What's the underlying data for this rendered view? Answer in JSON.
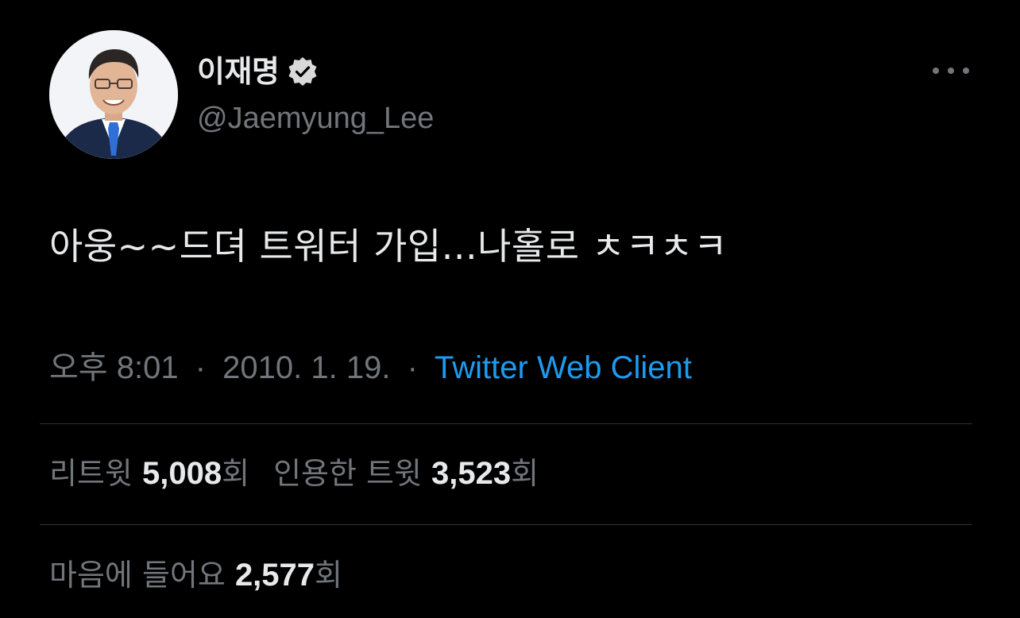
{
  "author": {
    "display_name": "이재명",
    "handle": "@Jaemyung_Lee",
    "verified": true,
    "avatar_icon": "profile-photo"
  },
  "more_icon": "more-horizontal-icon",
  "tweet": {
    "text": "아웅~~드뎌 트워터 가입...나홀로 ㅊㅋㅊㅋ"
  },
  "meta": {
    "time": "오후 8:01",
    "separator": "·",
    "date": "2010. 1. 19.",
    "client": "Twitter Web Client"
  },
  "stats": {
    "retweets_label": "리트윗",
    "retweets_count": "5,008",
    "retweets_unit": "회",
    "quotes_label": "인용한 트윗",
    "quotes_count": "3,523",
    "quotes_unit": "회",
    "likes_label": "마음에 들어요",
    "likes_count": "2,577",
    "likes_unit": "회"
  },
  "colors": {
    "background": "#000000",
    "primary_text": "#e7e9ea",
    "secondary_text": "#71767b",
    "link": "#1d9bf0",
    "divider": "#2f3336",
    "verified_badge": "#d9d9d9"
  }
}
